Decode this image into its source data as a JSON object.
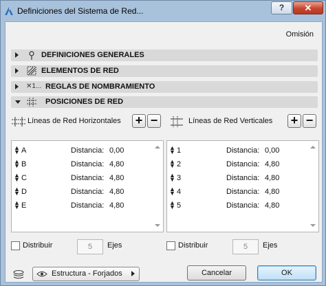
{
  "window": {
    "title": "Definiciones del Sistema de Red...",
    "help_label": "?",
    "close_label": "✕"
  },
  "omision_label": "Omisión",
  "sections": [
    {
      "label": "DEFINICIONES GENERALES",
      "icon": "pin-icon",
      "expanded": false
    },
    {
      "label": "ELEMENTOS DE RED",
      "icon": "hatched-square-icon",
      "expanded": false
    },
    {
      "label": "REGLAS DE NOMBRAMIENTO",
      "icon_text": "✕1...",
      "expanded": false
    },
    {
      "label": "POSICIONES DE RED",
      "icon": "grid-icon",
      "expanded": true
    }
  ],
  "horizontal": {
    "title": "Líneas de Red Horizontales",
    "add_label": "+",
    "remove_label": "−",
    "rows": [
      {
        "name": "A",
        "distance_label": "Distancia:",
        "value": "0,00"
      },
      {
        "name": "B",
        "distance_label": "Distancia:",
        "value": "4,80"
      },
      {
        "name": "C",
        "distance_label": "Distancia:",
        "value": "4,80"
      },
      {
        "name": "D",
        "distance_label": "Distancia:",
        "value": "4,80"
      },
      {
        "name": "E",
        "distance_label": "Distancia:",
        "value": "4,80"
      }
    ],
    "distribute_label": "Distribuir",
    "count": "5",
    "axes_label": "Ejes"
  },
  "vertical": {
    "title": "Líneas de Red Verticales",
    "add_label": "+",
    "remove_label": "−",
    "rows": [
      {
        "name": "1",
        "distance_label": "Distancia:",
        "value": "0,00"
      },
      {
        "name": "2",
        "distance_label": "Distancia:",
        "value": "4,80"
      },
      {
        "name": "3",
        "distance_label": "Distancia:",
        "value": "4,80"
      },
      {
        "name": "4",
        "distance_label": "Distancia:",
        "value": "4,80"
      },
      {
        "name": "5",
        "distance_label": "Distancia:",
        "value": "4,80"
      }
    ],
    "distribute_label": "Distribuir",
    "count": "5",
    "axes_label": "Ejes"
  },
  "footer": {
    "layer_value": "Estructura - Forjados",
    "cancel_label": "Cancelar",
    "ok_label": "OK"
  },
  "colors": {
    "frame": "#a9c2dc",
    "close": "#c7452d",
    "section_bg": "#d9d9d9",
    "ok_border": "#3c7fb1"
  }
}
